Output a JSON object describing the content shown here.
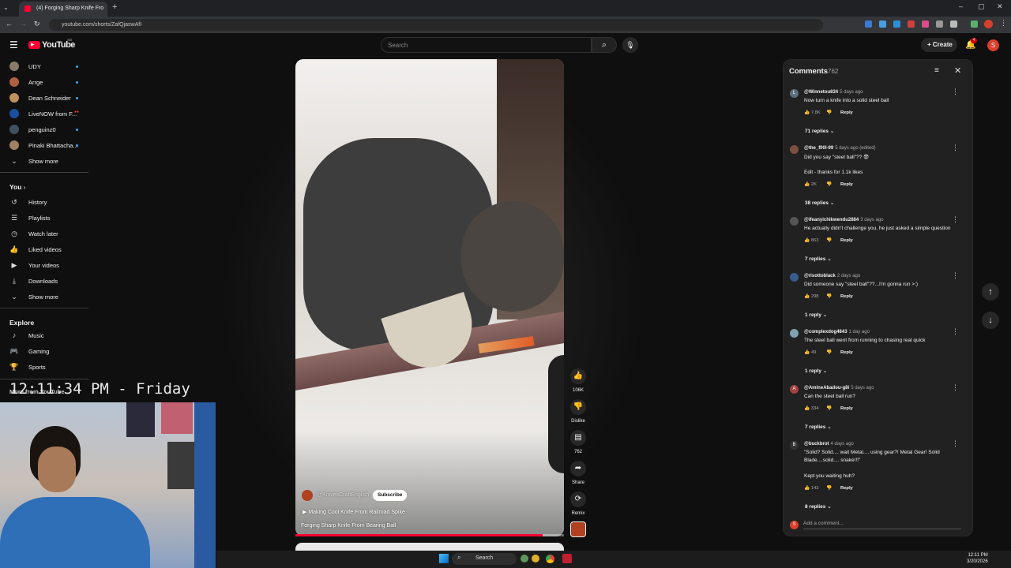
{
  "browser": {
    "tab_title": "(4) Forging Sharp Knife Fro",
    "url": "youtube.com/shorts/ZafQjaswAfI",
    "window_controls": [
      "–",
      "▢",
      "✕"
    ]
  },
  "header": {
    "logo": "YouTube",
    "logo_superscript": "SG",
    "search_placeholder": "Search",
    "create_label": "Create",
    "notif_count": "4",
    "avatar_letter": "S"
  },
  "sidebar": {
    "subscriptions": [
      {
        "label": "UDY",
        "color": "#8a7a6a"
      },
      {
        "label": "Arrge",
        "color": "#b06040"
      },
      {
        "label": "Dean Schneider",
        "color": "#c09060"
      },
      {
        "label": "LiveNOW from F...",
        "color": "#1a4fa0",
        "live": "●●"
      },
      {
        "label": "penguinz0",
        "color": "#405060"
      },
      {
        "label": "Pinaki Bhattacha...",
        "color": "#a08060"
      }
    ],
    "show_more_1": "Show more",
    "you_title": "You",
    "you_items": [
      {
        "label": "History",
        "icon": "history-icon",
        "glyph": "↺"
      },
      {
        "label": "Playlists",
        "icon": "playlists-icon",
        "glyph": "☰"
      },
      {
        "label": "Watch later",
        "icon": "clock-icon",
        "glyph": "◷"
      },
      {
        "label": "Liked videos",
        "icon": "thumb-up-icon",
        "glyph": "👍"
      },
      {
        "label": "Your videos",
        "icon": "video-icon",
        "glyph": "▶"
      },
      {
        "label": "Downloads",
        "icon": "download-icon",
        "glyph": "⤓"
      }
    ],
    "show_more_2": "Show more",
    "explore_title": "Explore",
    "explore_items": [
      {
        "label": "Music",
        "icon": "music-icon",
        "glyph": "♪"
      },
      {
        "label": "Gaming",
        "icon": "gaming-icon",
        "glyph": "🎮"
      },
      {
        "label": "Sports",
        "icon": "trophy-icon",
        "glyph": "🏆"
      }
    ],
    "more_from": "More from YouTube"
  },
  "overlay": {
    "clock": "12:11:34 PM - Friday"
  },
  "short": {
    "channel": "@KnivesCraftEnglish",
    "subscribe_label": "Subscribe",
    "related": "Making Cool Knife From Railroad Spike",
    "title": "Forging Sharp Knife From Bearing Ball",
    "progress": 0.92,
    "actions": {
      "likes": "106K",
      "dislike": "Dislike",
      "comments": "762",
      "share": "Share",
      "remix": "Remix"
    }
  },
  "comments": {
    "title": "Comments",
    "count": "762",
    "items": [
      {
        "author": "@Winnetou834",
        "time": "5 days ago",
        "avatar": "L",
        "color": "#5c6f7c",
        "text": "Now turn a knife into a solid steel ball",
        "text2": "",
        "likes": "7.8K",
        "replies": "71 replies"
      },
      {
        "author": "@the_f00l-99",
        "time": "5 days ago (edited)",
        "avatar": "",
        "color": "#7a5040",
        "text": "Did you say \"steel ball\"?? 😨",
        "text2": "Edit - thanks for 1.1k likes",
        "likes": "2K",
        "replies": "38 replies"
      },
      {
        "author": "@ifeanyichikwendu2884",
        "time": "3 days ago",
        "avatar": "",
        "color": "#555",
        "text": "He actually didn't challenge you, he just asked a simple question",
        "text2": "",
        "likes": "863",
        "replies": "7 replies"
      },
      {
        "author": "@risottoblack",
        "time": "2 days ago",
        "avatar": "",
        "color": "#3a5a8a",
        "text": "Did someone say \"steel ball\"??...I'm gonna run >:)",
        "text2": "",
        "likes": "298",
        "replies": "1 reply"
      },
      {
        "author": "@complexdog4843",
        "time": "1 day ago",
        "avatar": "",
        "color": "#7fa0b0",
        "text": "The steel ball went from running to chasing real quick",
        "text2": "",
        "likes": "49",
        "replies": "1 reply"
      },
      {
        "author": "@AmineAbadou-g8i",
        "time": "5 days ago",
        "avatar": "A",
        "color": "#a04040",
        "text": "Can the steel ball run?",
        "text2": "",
        "likes": "334",
        "replies": "7 replies"
      },
      {
        "author": "@buckbrot",
        "time": "4 days ago",
        "avatar": "B",
        "color": "#333",
        "text": "\"Solid? Solid.... wait Metal.... using gear?! Metal Gear! Solid",
        "text2": "Blade....solid.... snake!!!\"",
        "text3": "Kept you waiting huh?",
        "likes": "143",
        "replies": "8 replies"
      }
    ],
    "reply_label": "Reply",
    "add_placeholder": "Add a comment..."
  },
  "taskbar": {
    "search": "Search",
    "time": "12:11 PM",
    "date": "3/20/2026"
  }
}
